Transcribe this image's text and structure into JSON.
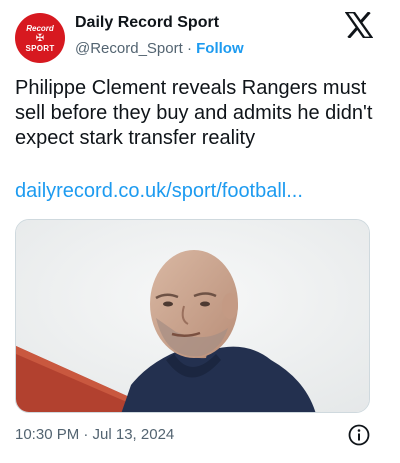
{
  "author": {
    "avatar_line1": "Record",
    "avatar_line2": "✠",
    "avatar_line3": "SPORT",
    "display_name": "Daily Record Sport",
    "handle": "@Record_Sport",
    "separator": " · ",
    "follow_label": "Follow"
  },
  "platform_icon": "x-logo-icon",
  "tweet": {
    "text": "Philippe Clement reveals Rangers must sell before they buy and admits he didn't expect stark transfer reality",
    "link": "dailyrecord.co.uk/sport/football..."
  },
  "footer": {
    "timestamp": "10:30 PM · Jul 13, 2024",
    "info_icon": "info-icon"
  },
  "colors": {
    "brand_red": "#d71920",
    "link_blue": "#1d9bf0",
    "secondary_text": "#536471"
  }
}
